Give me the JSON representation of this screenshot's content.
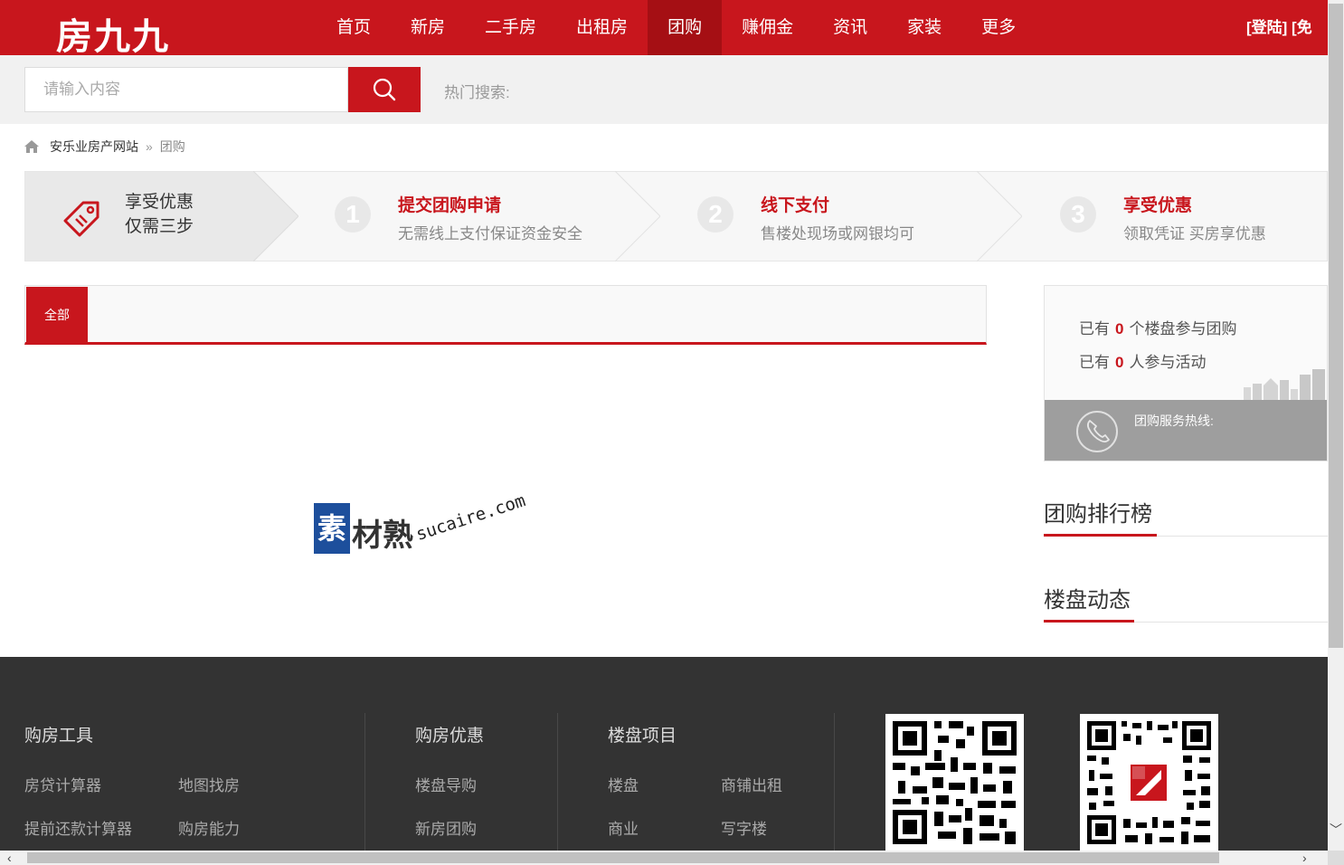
{
  "header": {
    "logo": "房九九",
    "nav": [
      "首页",
      "新房",
      "二手房",
      "出租房",
      "团购",
      "赚佣金",
      "资讯",
      "家装",
      "更多"
    ],
    "active_nav": "团购",
    "login": "[登陆] [免"
  },
  "search": {
    "placeholder": "请输入内容",
    "hot_label": "热门搜索:"
  },
  "breadcrumb": {
    "site": "安乐业房产网站",
    "separator": "»",
    "current": "团购"
  },
  "steps": {
    "intro_line1": "享受优惠",
    "intro_line2": "仅需三步",
    "items": [
      {
        "num": "1",
        "title": "提交团购申请",
        "desc": "无需线上支付保证资金安全"
      },
      {
        "num": "2",
        "title": "线下支付",
        "desc": "售楼处现场或网银均可"
      },
      {
        "num": "3",
        "title": "享受优惠",
        "desc": "领取凭证 买房享优惠"
      }
    ]
  },
  "tabs": {
    "all": "全部"
  },
  "watermark": {
    "box": "素",
    "cn": "材熟",
    "en": "sucaire.com"
  },
  "sidebar": {
    "stat1_prefix": "已有",
    "stat1_value": "0",
    "stat1_suffix": "个楼盘参与团购",
    "stat2_prefix": "已有",
    "stat2_value": "0",
    "stat2_suffix": "人参与活动",
    "hotline_label": "团购服务热线:",
    "ranking_title": "团购排行榜",
    "news_title": "楼盘动态"
  },
  "footer": {
    "tools_title": "购房工具",
    "tools": [
      "房贷计算器",
      "地图找房",
      "提前还款计算器",
      "购房能力"
    ],
    "offers_title": "购房优惠",
    "offers": [
      "楼盘导购",
      "新房团购"
    ],
    "projects_title": "楼盘项目",
    "projects": [
      "楼盘",
      "商铺出租",
      "商业",
      "写字楼"
    ]
  },
  "colors": {
    "brand_red": "#c8161d",
    "footer_bg": "#333333"
  }
}
